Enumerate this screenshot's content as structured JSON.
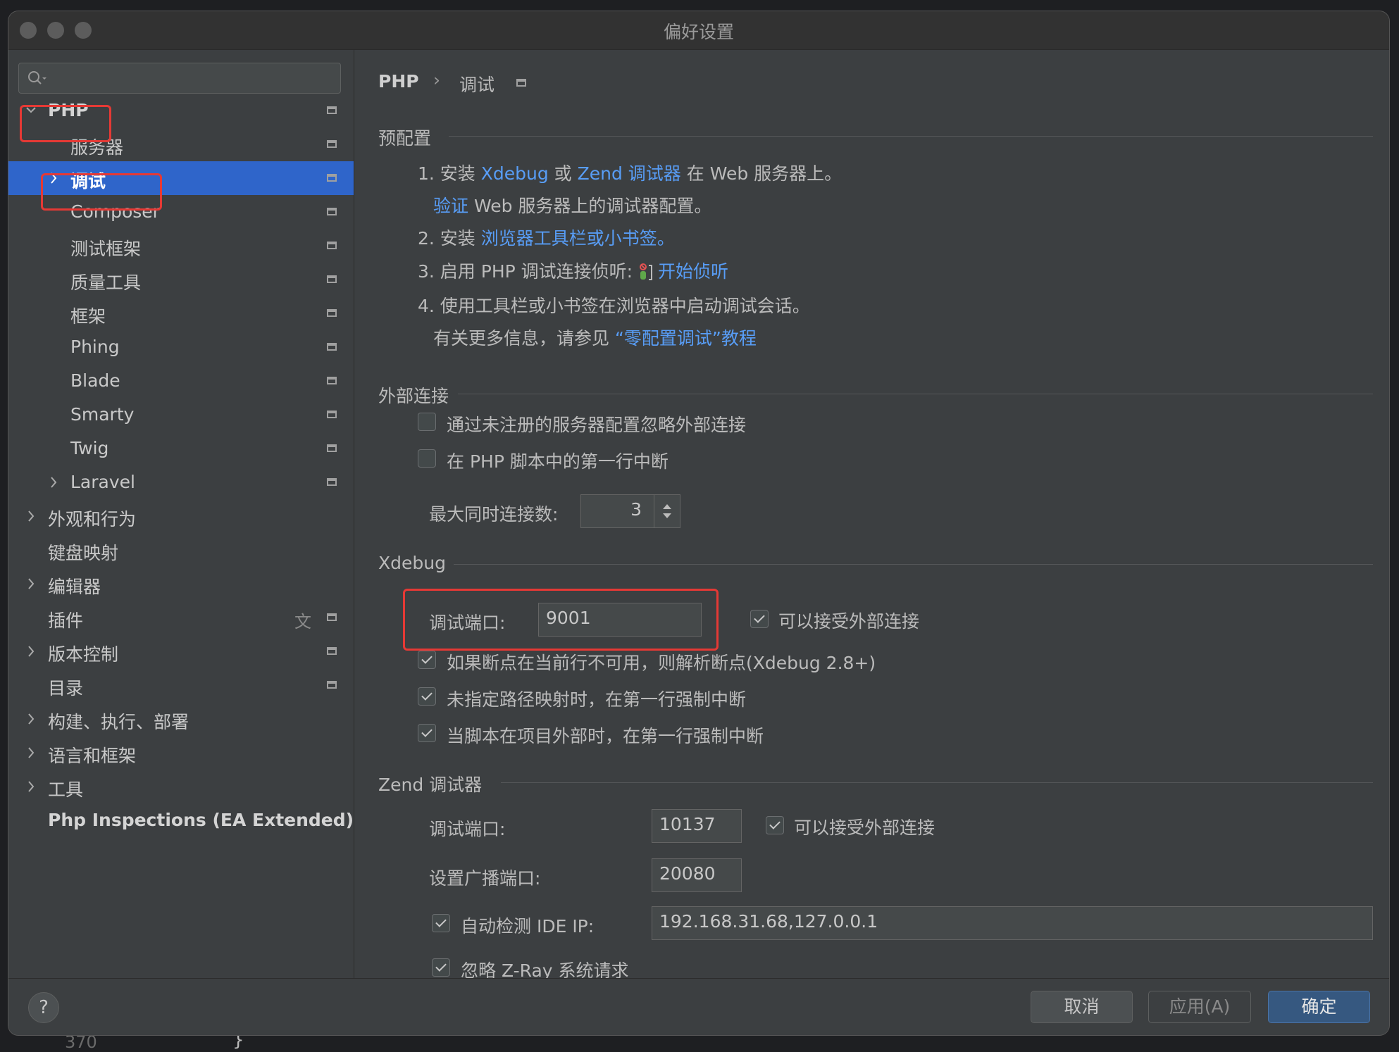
{
  "window": {
    "title": "偏好设置"
  },
  "background_text": {
    "line_number": "370",
    "brace": "}"
  },
  "sidebar": {
    "search": {
      "placeholder": ""
    },
    "items": [
      {
        "label": "PHP",
        "level": 0,
        "expandable": true,
        "expanded": true,
        "bold": true
      },
      {
        "label": "服务器",
        "level": 1
      },
      {
        "label": "调试",
        "level": 1,
        "expandable": true,
        "selected": true
      },
      {
        "label": "Composer",
        "level": 1
      },
      {
        "label": "测试框架",
        "level": 1
      },
      {
        "label": "质量工具",
        "level": 1
      },
      {
        "label": "框架",
        "level": 1
      },
      {
        "label": "Phing",
        "level": 1
      },
      {
        "label": "Blade",
        "level": 1
      },
      {
        "label": "Smarty",
        "level": 1
      },
      {
        "label": "Twig",
        "level": 1
      },
      {
        "label": "Laravel",
        "level": 1,
        "expandable": true
      },
      {
        "label": "外观和行为",
        "level": 0,
        "expandable": true
      },
      {
        "label": "键盘映射",
        "level": 0
      },
      {
        "label": "编辑器",
        "level": 0,
        "expandable": true
      },
      {
        "label": "插件",
        "level": 0
      },
      {
        "label": "版本控制",
        "level": 0,
        "expandable": true
      },
      {
        "label": "目录",
        "level": 0
      },
      {
        "label": "构建、执行、部署",
        "level": 0,
        "expandable": true
      },
      {
        "label": "语言和框架",
        "level": 0,
        "expandable": true
      },
      {
        "label": "工具",
        "level": 0,
        "expandable": true
      },
      {
        "label": "Php Inspections (EA Extended)",
        "level": 0,
        "bold": true
      }
    ]
  },
  "breadcrumb": {
    "root": "PHP",
    "separator": "›",
    "current": "调试"
  },
  "preconfig": {
    "title": "预配置",
    "step1_a": "1. 安装 ",
    "step1_xdebug": "Xdebug",
    "step1_or": " 或 ",
    "step1_zend": "Zend 调试器",
    "step1_b": " 在 Web 服务器上。",
    "step1_validate": "验证",
    "step1_c": " Web 服务器上的调试器配置。",
    "step2_a": "2. 安装 ",
    "step2_link": "浏览器工具栏或小书签。",
    "step3_a": "3. 启用 PHP 调试连接侦听: ",
    "step3_link": "开始侦听",
    "step4": "4. 使用工具栏或小书签在浏览器中启动调试会话。",
    "more_a": "有关更多信息，请参见 ",
    "more_link": "“零配置调试”教程"
  },
  "external": {
    "title": "外部连接",
    "ignore_unregistered": {
      "label": "通过未注册的服务器配置忽略外部连接",
      "checked": false
    },
    "break_first_line": {
      "label": "在 PHP 脚本中的第一行中断",
      "checked": false
    },
    "max_conn_label": "最大同时连接数:",
    "max_conn_value": "3"
  },
  "xdebug": {
    "title": "Xdebug",
    "port_label": "调试端口:",
    "port_value": "9001",
    "accept_external": {
      "label": "可以接受外部连接",
      "checked": true
    },
    "resolve_bp": {
      "label": "如果断点在当前行不可用，则解析断点(Xdebug 2.8+)",
      "checked": true
    },
    "force_break_no_mapping": {
      "label": "未指定路径映射时，在第一行强制中断",
      "checked": true
    },
    "force_break_outside": {
      "label": "当脚本在项目外部时，在第一行强制中断",
      "checked": true
    }
  },
  "zend": {
    "title": "Zend 调试器",
    "port_label": "调试端口:",
    "port_value": "10137",
    "accept_external": {
      "label": "可以接受外部连接",
      "checked": true
    },
    "broadcast_label": "设置广播端口:",
    "broadcast_value": "20080",
    "auto_detect": {
      "label": "自动检测 IDE IP:",
      "checked": true
    },
    "ide_ip_value": "192.168.31.68,127.0.0.1",
    "ignore_zray": {
      "label": "忽略 Z-Ray 系统请求",
      "checked": true
    }
  },
  "footer": {
    "help": "?",
    "cancel": "取消",
    "apply": "应用(A)",
    "ok": "确定"
  },
  "colors": {
    "accent": "#2f65ca",
    "link": "#589df6",
    "highlight": "#e53935",
    "primary_button": "#365880"
  }
}
